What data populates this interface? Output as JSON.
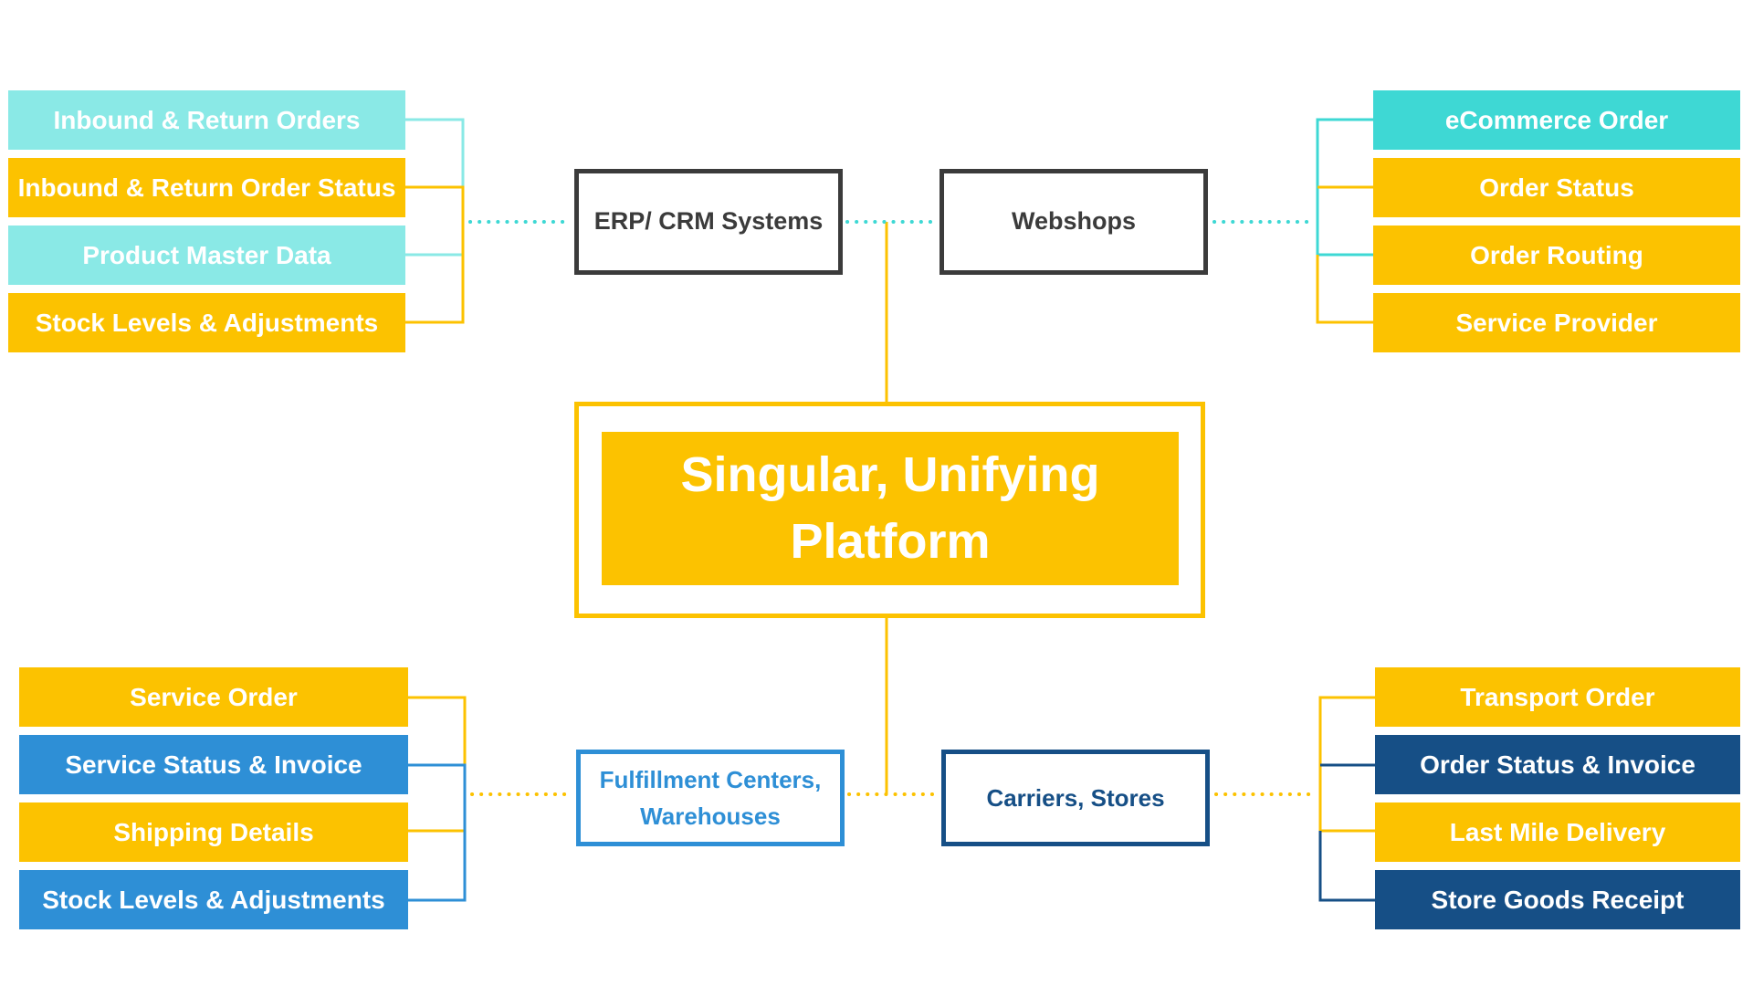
{
  "colors": {
    "light_cyan": "#8AE9E6",
    "teal": "#3ED8D4",
    "yellow": "#FCC200",
    "blue": "#2E8FD6",
    "navy": "#164F86",
    "dark": "#3B3B3B"
  },
  "center": {
    "title_line1": "Singular, Unifying",
    "title_line2": "Platform"
  },
  "nodes": {
    "erp": "ERP/ CRM Systems",
    "webshops": "Webshops",
    "fulfillment_line1": "Fulfillment Centers,",
    "fulfillment_line2": "Warehouses",
    "carriers": "Carriers, Stores"
  },
  "top_left": [
    "Inbound & Return Orders",
    "Inbound & Return Order Status",
    "Product Master Data",
    "Stock Levels & Adjustments"
  ],
  "top_right": [
    "eCommerce Order",
    "Order Status",
    "Order Routing",
    "Service Provider"
  ],
  "bottom_left": [
    "Service Order",
    "Service Status & Invoice",
    "Shipping Details",
    "Stock Levels & Adjustments"
  ],
  "bottom_right": [
    "Transport Order",
    "Order Status & Invoice",
    "Last Mile Delivery",
    "Store Goods Receipt"
  ]
}
